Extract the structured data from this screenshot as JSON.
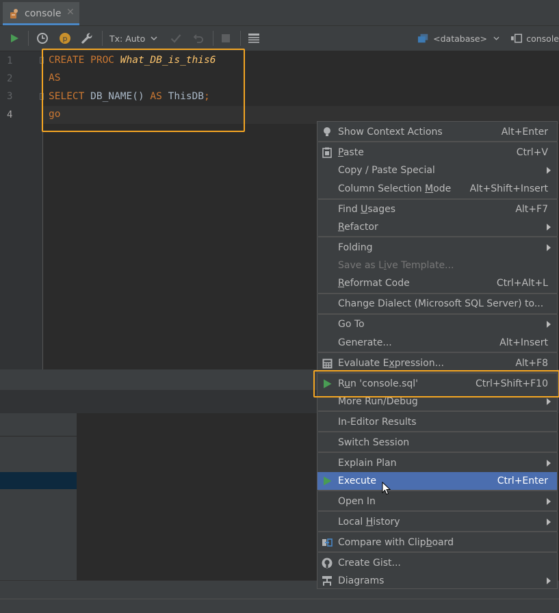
{
  "tab": {
    "title": "console",
    "close_glyph": "✕"
  },
  "toolbar": {
    "tx_mode": "Tx: Auto",
    "database": "<database>",
    "session": "console"
  },
  "editor": {
    "line_numbers": [
      "1",
      "2",
      "3",
      "4"
    ],
    "code": {
      "l1_kw": "CREATE PROC ",
      "l1_name": "What_DB_is_this6",
      "l2": "AS",
      "l3_kw": "SELECT ",
      "l3_fn": "DB_NAME() ",
      "l3_as": "AS ",
      "l3_id": "ThisDB",
      "l3_semi": ";",
      "l4": "go"
    }
  },
  "menu": {
    "items": [
      {
        "label": "Show Context Actions",
        "shortcut": "Alt+Enter",
        "icon": "lightbulb-icon"
      },
      {
        "label_pre": "",
        "label_u": "P",
        "label_post": "aste",
        "shortcut": "Ctrl+V",
        "icon": "clipboard-icon"
      },
      {
        "label": "Copy / Paste Special"
      },
      {
        "label_pre": "Column Selection ",
        "label_u": "M",
        "label_post": "ode",
        "shortcut": "Alt+Shift+Insert"
      },
      {
        "label_pre": "Find ",
        "label_u": "U",
        "label_post": "sages",
        "shortcut": "Alt+F7"
      },
      {
        "label_pre": "",
        "label_u": "R",
        "label_post": "efactor"
      },
      {
        "label": "Folding"
      },
      {
        "label_pre": "Save as L",
        "label_u": "i",
        "label_post": "ve Template..."
      },
      {
        "label_pre": "",
        "label_u": "R",
        "label_post": "eformat Code",
        "shortcut": "Ctrl+Alt+L"
      },
      {
        "label": "Change Dialect (Microsoft SQL Server) to..."
      },
      {
        "label": "Go To"
      },
      {
        "label": "Generate...",
        "shortcut": "Alt+Insert"
      },
      {
        "label_pre": "Evaluate E",
        "label_u": "x",
        "label_post": "pression...",
        "shortcut": "Alt+F8",
        "icon": "calculator-icon"
      },
      {
        "label_pre": "R",
        "label_u": "u",
        "label_post": "n 'console.sql'",
        "shortcut": "Ctrl+Shift+F10",
        "icon": "run-icon"
      },
      {
        "label": "More Run/Debug"
      },
      {
        "label": "In-Editor Results"
      },
      {
        "label": "Switch Session"
      },
      {
        "label": "Explain Plan"
      },
      {
        "label": "Execute",
        "shortcut": "Ctrl+Enter",
        "icon": "execute-icon"
      },
      {
        "label": "Open In"
      },
      {
        "label_pre": "Local ",
        "label_u": "H",
        "label_post": "istory"
      },
      {
        "label_pre": "Compare with Clip",
        "label_u": "b",
        "label_post": "oard",
        "icon": "compare-icon"
      },
      {
        "label": "Create Gist...",
        "icon": "github-icon"
      },
      {
        "label": "Diagrams",
        "icon": "diagram-icon"
      }
    ]
  },
  "colors": {
    "highlight": "#f5a623",
    "selection": "#4b6eaf",
    "keyword": "#cc7832",
    "proc_name": "#ffc66d",
    "run_green": "#499c54"
  }
}
